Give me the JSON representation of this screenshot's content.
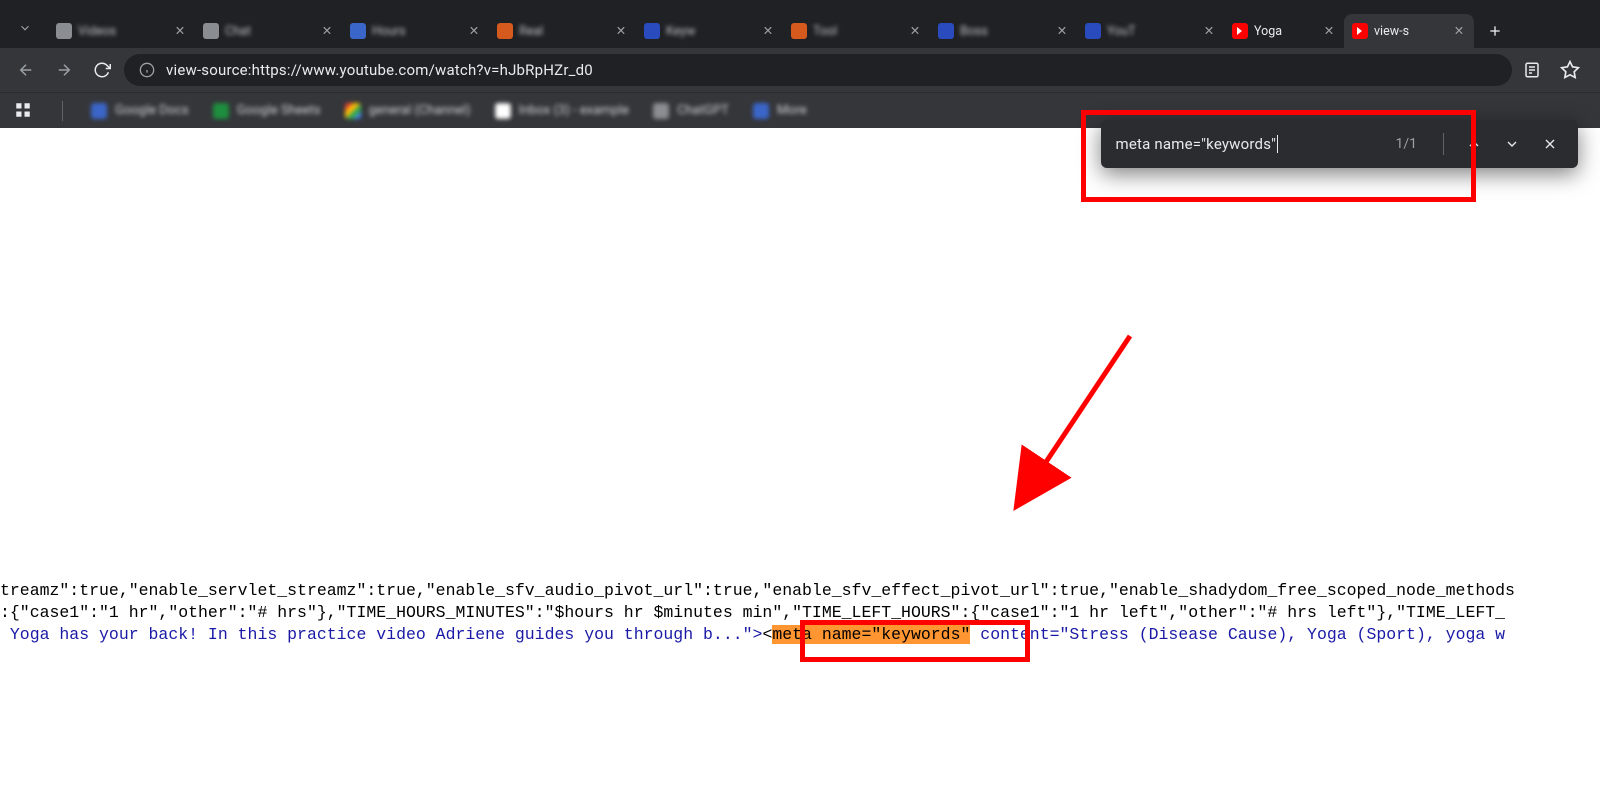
{
  "tabs": {
    "items": [
      {
        "label": "Videos"
      },
      {
        "label": "Chat"
      },
      {
        "label": "Hours"
      },
      {
        "label": "Real"
      },
      {
        "label": "Keyw"
      },
      {
        "label": "Tool"
      },
      {
        "label": "Boss"
      },
      {
        "label": "YouT"
      }
    ],
    "yoga_label": "Yoga",
    "active_label": "view-s"
  },
  "toolbar": {
    "url": "view-source:https://www.youtube.com/watch?v=hJbRpHZr_d0"
  },
  "bookmarks": {
    "items": [
      {
        "label": "Google Docs"
      },
      {
        "label": "Google Sheets"
      },
      {
        "label": "general (Channel)"
      },
      {
        "label": "Inbox (3) - example"
      },
      {
        "label": "ChatGPT"
      },
      {
        "label": "More"
      }
    ]
  },
  "find": {
    "query": "meta name=\"keywords\"",
    "count": "1/1"
  },
  "source": {
    "line1_a": "treamz\":true,\"enable_servlet_streamz\":true,\"enable_sfv_audio_pivot_url\":true,\"enable_sfv_effect_pivot_url\":true,\"enable_shadydom_free_scoped_node_methods",
    "line2_a": ":{\"case1\":\"1 hr\",\"other\":\"# hrs\"},\"TIME_HOURS_MINUTES\":\"$hours hr $minutes min\",\"TIME_LEFT_HOURS\":{\"case1\":\"1 hr left\",\"other\":\"# hrs left\"},\"TIME_LEFT_",
    "line3_pre": " Yoga has your back! In this practice video Adriene guides you through b...\">",
    "line3_hl": "meta name=\"keywords\"",
    "line3_post": " content=\"Stress (Disease Cause), Yoga (Sport), yoga w",
    "lt": "<"
  }
}
